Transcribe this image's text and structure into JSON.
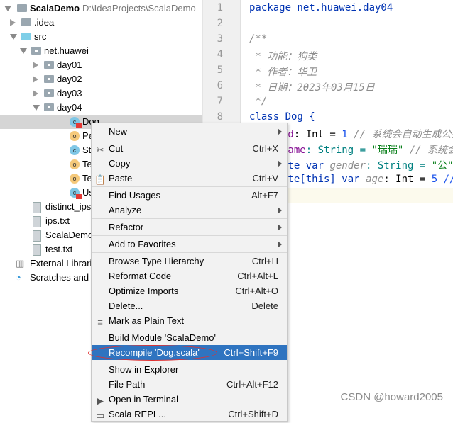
{
  "project": {
    "name": "ScalaDemo",
    "path": "D:\\IdeaProjects\\ScalaDemo"
  },
  "tree": [
    {
      "label": ".idea",
      "type": "folder"
    },
    {
      "label": "src",
      "type": "folder-src"
    },
    {
      "label": "net.huawei",
      "type": "package"
    },
    {
      "label": "day01",
      "type": "package"
    },
    {
      "label": "day02",
      "type": "package"
    },
    {
      "label": "day03",
      "type": "package"
    },
    {
      "label": "day04",
      "type": "package"
    },
    {
      "label": "Dog",
      "type": "class-error"
    },
    {
      "label": "Pe",
      "type": "object"
    },
    {
      "label": "Str",
      "type": "class"
    },
    {
      "label": "Te",
      "type": "object"
    },
    {
      "label": "Te",
      "type": "object"
    },
    {
      "label": "Us",
      "type": "class-error"
    },
    {
      "label": "distinct_ips.t",
      "type": "file"
    },
    {
      "label": "ips.txt",
      "type": "file"
    },
    {
      "label": "ScalaDemo.",
      "type": "file"
    },
    {
      "label": "test.txt",
      "type": "file"
    },
    {
      "label": "External Librari",
      "type": "libraries"
    },
    {
      "label": "Scratches and",
      "type": "scratches"
    }
  ],
  "editor": {
    "line_numbers": [
      "1",
      "2",
      "3",
      "4",
      "5",
      "6",
      "7",
      "8"
    ],
    "lines": [
      "package net.huawei.day04",
      "",
      "/**",
      " * 功能：狗类",
      " * 作者：华卫",
      " * 日期：2023年03月15日",
      " */",
      "class Dog {"
    ],
    "partial": [
      {
        "a": "id",
        "b": ": Int = ",
        "c": "1",
        "d": " // 系统会自动生成公共"
      },
      {
        "a": "name",
        "b": ": String = ",
        "c": "\"瑞瑞\"",
        "d": " // 系统会"
      },
      {
        "a": "ate var ",
        "b": "gender",
        "c": ": String = ",
        "d": "\"公\""
      },
      {
        "a": "ate[this] var ",
        "b": "age",
        "c": ": Int = ",
        "d": "5 //"
      }
    ]
  },
  "menu": [
    {
      "label": "New",
      "submenu": true
    },
    {
      "label": "Cut",
      "shortcut": "Ctrl+X",
      "icon": "scissors-icon"
    },
    {
      "label": "Copy",
      "submenu": true
    },
    {
      "label": "Paste",
      "shortcut": "Ctrl+V",
      "icon": "clipboard-icon"
    },
    {
      "label": "Find Usages",
      "shortcut": "Alt+F7"
    },
    {
      "label": "Analyze",
      "submenu": true
    },
    {
      "label": "Refactor",
      "submenu": true
    },
    {
      "label": "Add to Favorites",
      "submenu": true
    },
    {
      "label": "Browse Type Hierarchy",
      "shortcut": "Ctrl+H"
    },
    {
      "label": "Reformat Code",
      "shortcut": "Ctrl+Alt+L"
    },
    {
      "label": "Optimize Imports",
      "shortcut": "Ctrl+Alt+O"
    },
    {
      "label": "Delete...",
      "shortcut": "Delete"
    },
    {
      "label": "Mark as Plain Text",
      "icon": "plain-text-icon"
    },
    {
      "label": "Build Module 'ScalaDemo'"
    },
    {
      "label": "Recompile 'Dog.scala'",
      "shortcut": "Ctrl+Shift+F9",
      "highlighted": true
    },
    {
      "label": "Show in Explorer"
    },
    {
      "label": "File Path",
      "shortcut": "Ctrl+Alt+F12"
    },
    {
      "label": "Open in Terminal",
      "icon": "terminal-icon"
    },
    {
      "label": "Scala REPL...",
      "shortcut": "Ctrl+Shift+D",
      "icon": "repl-icon"
    }
  ],
  "colors": {
    "highlight": "#2f74c0",
    "annotation": "#e03030"
  },
  "watermark": "CSDN @howard2005"
}
